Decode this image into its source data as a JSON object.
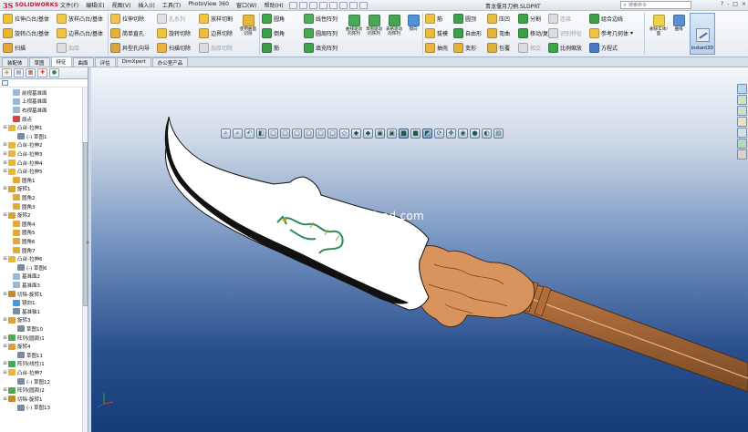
{
  "app": {
    "logo_mark": "3S",
    "logo_text": "SOLIDWORKS",
    "document_title": "青龙偃月刀柄.SLDPRT",
    "search_placeholder": "搜索命令",
    "window_controls": [
      "?",
      "-",
      "□",
      "×"
    ]
  },
  "menu": [
    "文件(F)",
    "编辑(E)",
    "视图(V)",
    "插入(I)",
    "工具(T)",
    "PhotoView 360",
    "窗口(W)",
    "帮助(H)"
  ],
  "ribbon": {
    "group1": [
      "拉伸凸台/基体",
      "旋转凸台/基体",
      "扫描"
    ],
    "group1b": [
      "放样凸台/基体",
      "边界凸台/基体",
      "加厚"
    ],
    "group2": [
      "拉伸切除",
      "简单直孔",
      "异型孔向导"
    ],
    "group2b": [
      "旋转切除",
      "孔系列",
      "扫描切除"
    ],
    "group3": [
      "放样切割",
      "边界切除",
      "加厚切除"
    ],
    "tall1": "使用曲面切除",
    "group4": [
      "圆角",
      "倒角",
      "筋"
    ],
    "group4b": [
      "线性阵列",
      "圆周阵列",
      "填充阵列"
    ],
    "tall2": "曲线驱动的阵列",
    "tall3": "草图驱动的阵列",
    "tall4": "表格驱动的阵列",
    "tall5": "镜向",
    "group5": [
      "筋",
      "拔模",
      "抽壳"
    ],
    "group5b": [
      "圆顶",
      "自由形",
      "变形"
    ],
    "group6": [
      "压凹",
      "弯曲",
      "包覆"
    ],
    "group6b": [
      "分割",
      "移动/复制",
      "相交"
    ],
    "group7": [
      "连接",
      "识别特征",
      "比例缩放"
    ],
    "group8": [
      "组合边线",
      "参考几何体",
      "方程式"
    ],
    "tall6": "删除实体/面",
    "tall7": "曲线",
    "instant3d": "Instant3D",
    "extra": [
      "参考几何体",
      "曲线"
    ]
  },
  "tabs": [
    "装配体",
    "草图",
    "特征",
    "曲面",
    "评估",
    "DimXpert",
    "办公室产品"
  ],
  "tree": [
    {
      "label": "前视基准面",
      "icon": "plane-icon",
      "indent": 1
    },
    {
      "label": "上视基准面",
      "icon": "plane-icon",
      "indent": 1
    },
    {
      "label": "右视基准面",
      "icon": "plane-icon",
      "indent": 1
    },
    {
      "label": "原点",
      "icon": "origin-icon",
      "indent": 1
    },
    {
      "label": "凸台-拉伸1",
      "icon": "extrude-icon",
      "indent": 0
    },
    {
      "label": "(-) 草图1",
      "icon": "sketch-icon",
      "indent": 2
    },
    {
      "label": "凸台-拉伸2",
      "icon": "extrude-icon",
      "indent": 0
    },
    {
      "label": "凸台-拉伸3",
      "icon": "extrude-icon",
      "indent": 0
    },
    {
      "label": "凸台-拉伸4",
      "icon": "extrude-icon",
      "indent": 0
    },
    {
      "label": "凸台-拉伸5",
      "icon": "extrude-icon",
      "indent": 0
    },
    {
      "label": "圆角1",
      "icon": "fillet-icon",
      "indent": 1
    },
    {
      "label": "旋转1",
      "icon": "revolve-icon",
      "indent": 0
    },
    {
      "label": "圆角2",
      "icon": "fillet-icon",
      "indent": 1
    },
    {
      "label": "圆角3",
      "icon": "fillet-icon",
      "indent": 1
    },
    {
      "label": "旋转2",
      "icon": "revolve-icon",
      "indent": 0
    },
    {
      "label": "圆角4",
      "icon": "fillet-icon",
      "indent": 1
    },
    {
      "label": "圆角5",
      "icon": "fillet-icon",
      "indent": 1
    },
    {
      "label": "圆角6",
      "icon": "fillet-icon",
      "indent": 1
    },
    {
      "label": "圆角7",
      "icon": "fillet-icon",
      "indent": 1
    },
    {
      "label": "凸台-拉伸6",
      "icon": "extrude-icon",
      "indent": 0
    },
    {
      "label": "(-) 草图6",
      "icon": "sketch-icon",
      "indent": 2
    },
    {
      "label": "基准面2",
      "icon": "plane-icon",
      "indent": 1
    },
    {
      "label": "基准面3",
      "icon": "plane-icon",
      "indent": 1
    },
    {
      "label": "切除-旋转1",
      "icon": "cut-icon",
      "indent": 0
    },
    {
      "label": "镜向1",
      "icon": "mirror-icon",
      "indent": 1
    },
    {
      "label": "基准轴1",
      "icon": "axis-icon",
      "indent": 1
    },
    {
      "label": "旋转3",
      "icon": "revolve-icon",
      "indent": 0
    },
    {
      "label": "草图10",
      "icon": "sketch-icon",
      "indent": 2
    },
    {
      "label": "阵列(圆周)1",
      "icon": "pattern-icon",
      "indent": 0
    },
    {
      "label": "旋转4",
      "icon": "revolve-icon",
      "indent": 0
    },
    {
      "label": "草图11",
      "icon": "sketch-icon",
      "indent": 2
    },
    {
      "label": "阵列(线性)1",
      "icon": "pattern-icon",
      "indent": 0
    },
    {
      "label": "凸台-拉伸7",
      "icon": "extrude-icon",
      "indent": 0
    },
    {
      "label": "(-) 草图12",
      "icon": "sketch-icon",
      "indent": 2
    },
    {
      "label": "阵列(圆周)2",
      "icon": "pattern-icon",
      "indent": 0
    },
    {
      "label": "切除-旋转1",
      "icon": "cut-icon",
      "indent": 0
    },
    {
      "label": "(-) 草图13",
      "icon": "sketch-icon",
      "indent": 2
    }
  ],
  "viewport": {
    "watermark": "www.mfcad.com",
    "colors": {
      "blade": "#ffffff",
      "blade_edge": "#1a1a1a",
      "guard": "#d9935d",
      "shaft": "#c17a45",
      "shaft_dark": "#7a4a24",
      "dragon": "#2f8c5a"
    }
  }
}
